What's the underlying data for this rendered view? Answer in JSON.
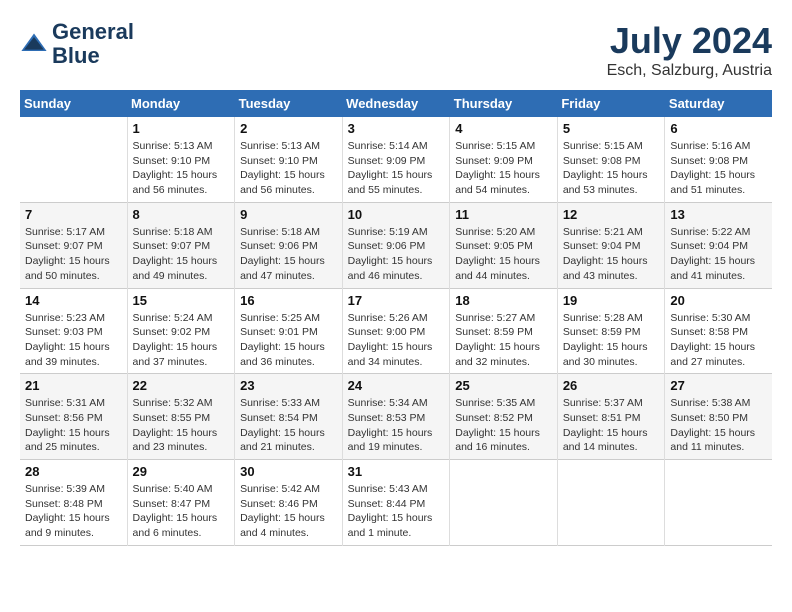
{
  "app": {
    "name": "GeneralBlue",
    "logo_line1": "General",
    "logo_line2": "Blue"
  },
  "calendar": {
    "title": "July 2024",
    "location": "Esch, Salzburg, Austria",
    "days_of_week": [
      "Sunday",
      "Monday",
      "Tuesday",
      "Wednesday",
      "Thursday",
      "Friday",
      "Saturday"
    ],
    "weeks": [
      [
        {
          "day": "",
          "info": ""
        },
        {
          "day": "1",
          "info": "Sunrise: 5:13 AM\nSunset: 9:10 PM\nDaylight: 15 hours\nand 56 minutes."
        },
        {
          "day": "2",
          "info": "Sunrise: 5:13 AM\nSunset: 9:10 PM\nDaylight: 15 hours\nand 56 minutes."
        },
        {
          "day": "3",
          "info": "Sunrise: 5:14 AM\nSunset: 9:09 PM\nDaylight: 15 hours\nand 55 minutes."
        },
        {
          "day": "4",
          "info": "Sunrise: 5:15 AM\nSunset: 9:09 PM\nDaylight: 15 hours\nand 54 minutes."
        },
        {
          "day": "5",
          "info": "Sunrise: 5:15 AM\nSunset: 9:08 PM\nDaylight: 15 hours\nand 53 minutes."
        },
        {
          "day": "6",
          "info": "Sunrise: 5:16 AM\nSunset: 9:08 PM\nDaylight: 15 hours\nand 51 minutes."
        }
      ],
      [
        {
          "day": "7",
          "info": "Sunrise: 5:17 AM\nSunset: 9:07 PM\nDaylight: 15 hours\nand 50 minutes."
        },
        {
          "day": "8",
          "info": "Sunrise: 5:18 AM\nSunset: 9:07 PM\nDaylight: 15 hours\nand 49 minutes."
        },
        {
          "day": "9",
          "info": "Sunrise: 5:18 AM\nSunset: 9:06 PM\nDaylight: 15 hours\nand 47 minutes."
        },
        {
          "day": "10",
          "info": "Sunrise: 5:19 AM\nSunset: 9:06 PM\nDaylight: 15 hours\nand 46 minutes."
        },
        {
          "day": "11",
          "info": "Sunrise: 5:20 AM\nSunset: 9:05 PM\nDaylight: 15 hours\nand 44 minutes."
        },
        {
          "day": "12",
          "info": "Sunrise: 5:21 AM\nSunset: 9:04 PM\nDaylight: 15 hours\nand 43 minutes."
        },
        {
          "day": "13",
          "info": "Sunrise: 5:22 AM\nSunset: 9:04 PM\nDaylight: 15 hours\nand 41 minutes."
        }
      ],
      [
        {
          "day": "14",
          "info": "Sunrise: 5:23 AM\nSunset: 9:03 PM\nDaylight: 15 hours\nand 39 minutes."
        },
        {
          "day": "15",
          "info": "Sunrise: 5:24 AM\nSunset: 9:02 PM\nDaylight: 15 hours\nand 37 minutes."
        },
        {
          "day": "16",
          "info": "Sunrise: 5:25 AM\nSunset: 9:01 PM\nDaylight: 15 hours\nand 36 minutes."
        },
        {
          "day": "17",
          "info": "Sunrise: 5:26 AM\nSunset: 9:00 PM\nDaylight: 15 hours\nand 34 minutes."
        },
        {
          "day": "18",
          "info": "Sunrise: 5:27 AM\nSunset: 8:59 PM\nDaylight: 15 hours\nand 32 minutes."
        },
        {
          "day": "19",
          "info": "Sunrise: 5:28 AM\nSunset: 8:59 PM\nDaylight: 15 hours\nand 30 minutes."
        },
        {
          "day": "20",
          "info": "Sunrise: 5:30 AM\nSunset: 8:58 PM\nDaylight: 15 hours\nand 27 minutes."
        }
      ],
      [
        {
          "day": "21",
          "info": "Sunrise: 5:31 AM\nSunset: 8:56 PM\nDaylight: 15 hours\nand 25 minutes."
        },
        {
          "day": "22",
          "info": "Sunrise: 5:32 AM\nSunset: 8:55 PM\nDaylight: 15 hours\nand 23 minutes."
        },
        {
          "day": "23",
          "info": "Sunrise: 5:33 AM\nSunset: 8:54 PM\nDaylight: 15 hours\nand 21 minutes."
        },
        {
          "day": "24",
          "info": "Sunrise: 5:34 AM\nSunset: 8:53 PM\nDaylight: 15 hours\nand 19 minutes."
        },
        {
          "day": "25",
          "info": "Sunrise: 5:35 AM\nSunset: 8:52 PM\nDaylight: 15 hours\nand 16 minutes."
        },
        {
          "day": "26",
          "info": "Sunrise: 5:37 AM\nSunset: 8:51 PM\nDaylight: 15 hours\nand 14 minutes."
        },
        {
          "day": "27",
          "info": "Sunrise: 5:38 AM\nSunset: 8:50 PM\nDaylight: 15 hours\nand 11 minutes."
        }
      ],
      [
        {
          "day": "28",
          "info": "Sunrise: 5:39 AM\nSunset: 8:48 PM\nDaylight: 15 hours\nand 9 minutes."
        },
        {
          "day": "29",
          "info": "Sunrise: 5:40 AM\nSunset: 8:47 PM\nDaylight: 15 hours\nand 6 minutes."
        },
        {
          "day": "30",
          "info": "Sunrise: 5:42 AM\nSunset: 8:46 PM\nDaylight: 15 hours\nand 4 minutes."
        },
        {
          "day": "31",
          "info": "Sunrise: 5:43 AM\nSunset: 8:44 PM\nDaylight: 15 hours\nand 1 minute."
        },
        {
          "day": "",
          "info": ""
        },
        {
          "day": "",
          "info": ""
        },
        {
          "day": "",
          "info": ""
        }
      ]
    ]
  }
}
